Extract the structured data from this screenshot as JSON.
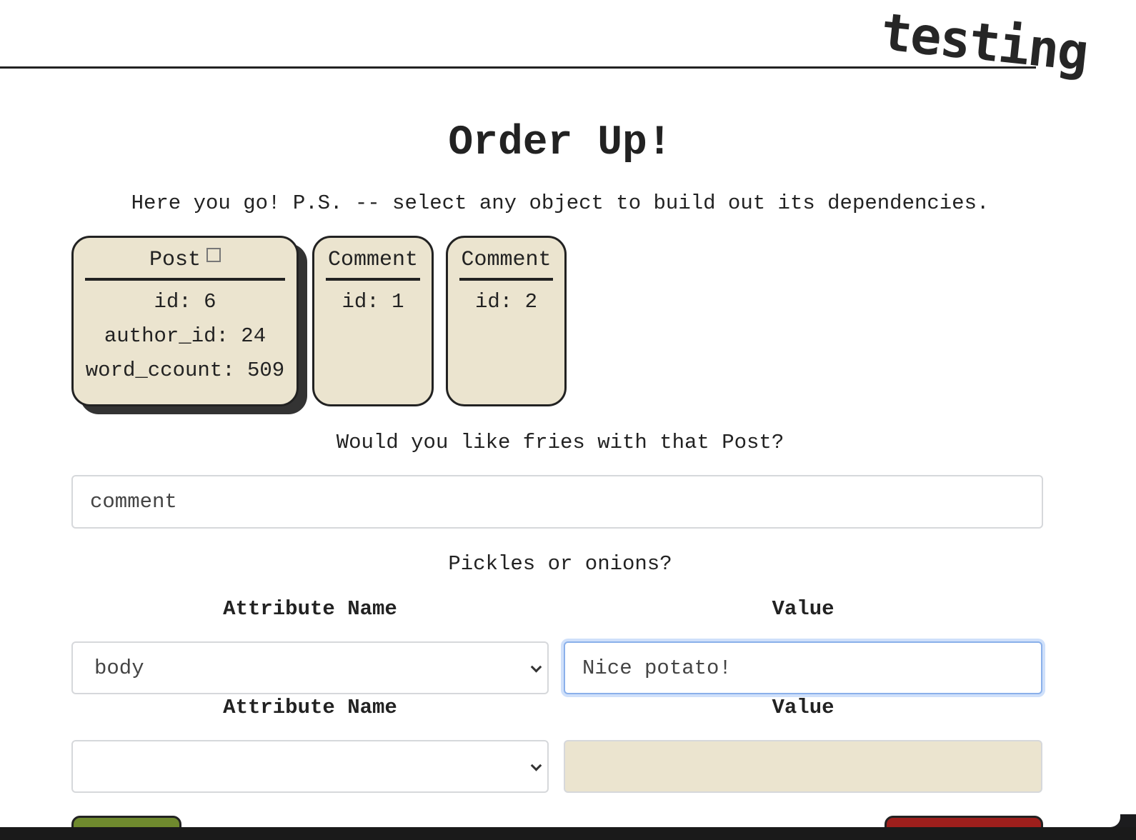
{
  "header": {
    "logo": "testing"
  },
  "main": {
    "title": "Order Up!",
    "subtitle": "Here you go! P.S. -- select any object to build out its dependencies.",
    "cards": [
      {
        "type": "Post",
        "rows": [
          "id: 6",
          "author_id: 24",
          "word_ccount: 509"
        ],
        "selected": true
      },
      {
        "type": "Comment",
        "rows": [
          "id: 1"
        ]
      },
      {
        "type": "Comment",
        "rows": [
          "id: 2"
        ]
      }
    ],
    "fries_question": "Would you like fries with that Post?",
    "association_value": "comment",
    "pickles_question": "Pickles or onions?",
    "attributes": [
      {
        "name_label": "Attribute Name",
        "value_label": "Value",
        "name": "body",
        "value": "Nice potato!"
      },
      {
        "name_label": "Attribute Name",
        "value_label": "Value",
        "name": "",
        "value": ""
      }
    ],
    "colors": {
      "card": "#ebe4cf",
      "add_button": "#6f8a2e",
      "remove_button": "#9e1f1c"
    }
  }
}
